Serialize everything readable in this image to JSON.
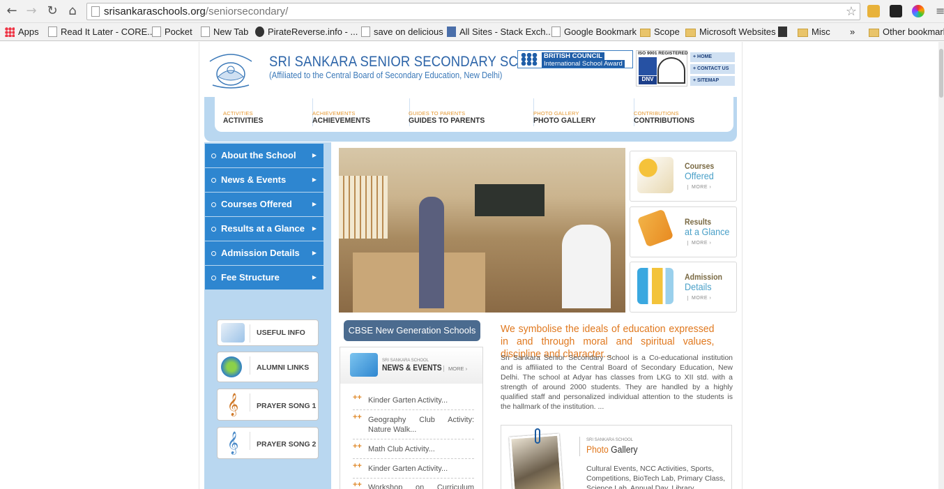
{
  "browser": {
    "url_domain": "srisankaraschools.org",
    "url_path": "/seniorsecondary/",
    "bookmarks": [
      {
        "label": "Apps",
        "icon": "apps-icon"
      },
      {
        "label": "Read It Later - CORE...",
        "icon": "page-icon"
      },
      {
        "label": "Pocket",
        "icon": "page-icon"
      },
      {
        "label": "New Tab",
        "icon": "page-icon"
      },
      {
        "label": "PirateReverse.info - ...",
        "icon": "pirate-icon"
      },
      {
        "label": "save on delicious",
        "icon": "page-icon"
      },
      {
        "label": "All Sites - Stack Exch...",
        "icon": "stackexchange-icon"
      },
      {
        "label": "Google Bookmark",
        "icon": "page-icon"
      },
      {
        "label": "Scope",
        "icon": "folder-icon"
      },
      {
        "label": "Microsoft Websites",
        "icon": "folder-icon"
      },
      {
        "label": "",
        "icon": "pen-icon"
      },
      {
        "label": "Misc",
        "icon": "folder-icon"
      },
      {
        "label": "»",
        "icon": ""
      },
      {
        "label": "Other bookmarks",
        "icon": "folder-icon"
      }
    ]
  },
  "header": {
    "school_name": "SRI SANKARA SENIOR SECONDARY SCHOOL",
    "affiliation": "(Affiliated to the Central Board of Secondary Education, New Delhi)",
    "british_council_line1": "BRITISH COUNCIL",
    "british_council_line2": "International School Award",
    "iso_text": "ISO 9001 REGISTERED",
    "dnv": "DNV",
    "top_links": [
      "+ HOME",
      "+ CONTACT US",
      "+ SITEMAP"
    ]
  },
  "nav": [
    {
      "small": "ACTIVITIES",
      "label": "ACTIVITIES"
    },
    {
      "small": "ACHIEVEMENTS",
      "label": "ACHIEVEMENTS"
    },
    {
      "small": "GUIDES TO PARENTS",
      "label": "GUIDES TO PARENTS"
    },
    {
      "small": "PHOTO GALLERY",
      "label": "PHOTO GALLERY"
    },
    {
      "small": "CONTRIBUTIONS",
      "label": "CONTRIBUTIONS"
    }
  ],
  "side_menu": [
    "About the School",
    "News & Events",
    "Courses Offered",
    "Results at a Glance",
    "Admission Details",
    "Fee Structure"
  ],
  "quick_links": [
    {
      "label": "USEFUL INFO",
      "icon": "compass-icon"
    },
    {
      "label": "ALUMNI LINKS",
      "icon": "globe-icon"
    },
    {
      "label": "PRAYER SONG 1",
      "icon": "treble-clef-icon"
    },
    {
      "label": "PRAYER SONG 2",
      "icon": "treble-clef-icon"
    }
  ],
  "side_cards": [
    {
      "line1": "Courses",
      "line2": "Offered",
      "more": "MORE ›",
      "icon": "book-star-icon"
    },
    {
      "line1": "Results",
      "line2": "at a Glance",
      "more": "MORE ›",
      "icon": "clipboard-icon"
    },
    {
      "line1": "Admission",
      "line2": "Details",
      "more": "MORE ›",
      "icon": "chart-icon"
    }
  ],
  "cbse_button": "CBSE New Generation Schools",
  "news": {
    "kicker": "SRI SANKARA SCHOOL",
    "title": "NEWS & EVENTS",
    "more": "MORE ›",
    "items": [
      "Kinder Garten Activity...",
      "Geography Club Activity: Nature Walk...",
      "Math Club Activity...",
      "Kinder Garten Activity...",
      "Workshop on Curriculum"
    ]
  },
  "tagline": "We symbolise the ideals of education expressed in and through moral and spiritual values, discipline and character...",
  "intro": "Sri Sankara Senior Secondary School is a Co-educational institution and is affiliated to the Central Board of Secondary Education, New Delhi. The school at Adyar has classes from LKG to XII std. with a strength of around 2000 students. They are handled by a highly qualified staff and personalized individual attention to the students is the hallmark of the institution. ...",
  "gallery": {
    "kicker": "SRI SANKARA SCHOOL",
    "title_a": "Photo ",
    "title_b": "Gallery",
    "desc": "Cultural Events, NCC Activities, Sports, Competitions, BioTech Lab, Primary Class, Science Lab, Annual Day, Library..."
  },
  "colors": {
    "accent_blue": "#2e86d0",
    "light_blue": "#b9d7f0",
    "orange": "#e0781e",
    "title_blue": "#2c64a8"
  }
}
